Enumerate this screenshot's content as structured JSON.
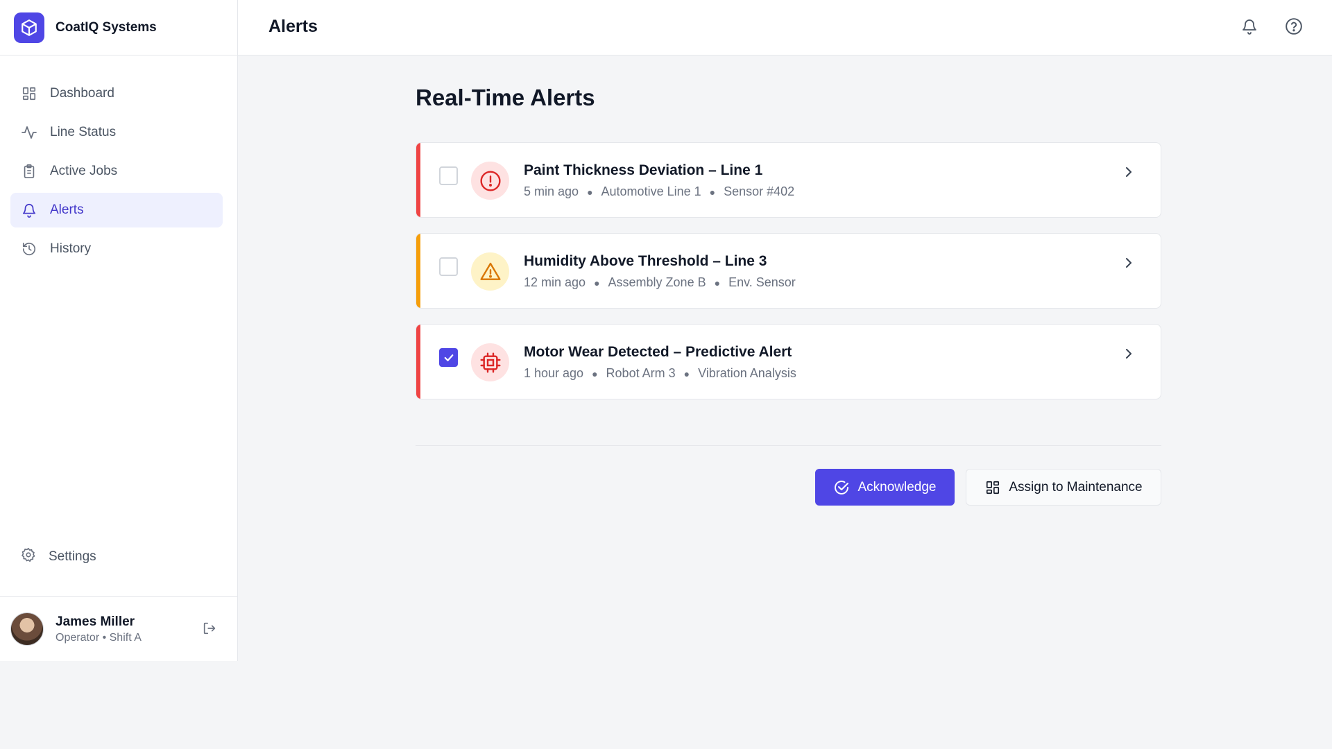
{
  "brand": {
    "name": "CoatIQ Systems",
    "logo_icon": "cube-icon",
    "accent": "#4f46e5"
  },
  "header": {
    "title": "Alerts",
    "icons": [
      "bell-icon",
      "help-circle-icon"
    ]
  },
  "sidebar": {
    "items": [
      {
        "label": "Dashboard",
        "icon": "grid-icon",
        "active": false
      },
      {
        "label": "Line Status",
        "icon": "activity-icon",
        "active": false
      },
      {
        "label": "Active Jobs",
        "icon": "clipboard-icon",
        "active": false
      },
      {
        "label": "Alerts",
        "icon": "bell-icon",
        "active": true
      },
      {
        "label": "History",
        "icon": "history-icon",
        "active": false
      }
    ],
    "settings": {
      "label": "Settings",
      "icon": "gear-icon"
    }
  },
  "user": {
    "name": "James Miller",
    "role": "Operator • Shift A"
  },
  "main": {
    "heading": "Real-Time Alerts",
    "alerts": [
      {
        "title": "Paint Thickness Deviation – Line 1",
        "time": "5 min ago",
        "location": "Automotive Line 1",
        "source": "Sensor #402",
        "severity_color": "#ef4444",
        "icon": "alert-circle-icon",
        "checked": false
      },
      {
        "title": "Humidity Above Threshold – Line 3",
        "time": "12 min ago",
        "location": "Assembly Zone B",
        "source": "Env. Sensor",
        "severity_color": "#f59e0b",
        "icon": "warning-triangle-icon",
        "checked": false
      },
      {
        "title": "Motor Wear Detected – Predictive Alert",
        "time": "1 hour ago",
        "location": "Robot Arm 3",
        "source": "Vibration Analysis",
        "severity_color": "#ef4444",
        "icon": "cpu-chip-icon",
        "checked": true
      }
    ],
    "actions": {
      "acknowledge": "Acknowledge",
      "assign": "Assign to Maintenance"
    }
  }
}
